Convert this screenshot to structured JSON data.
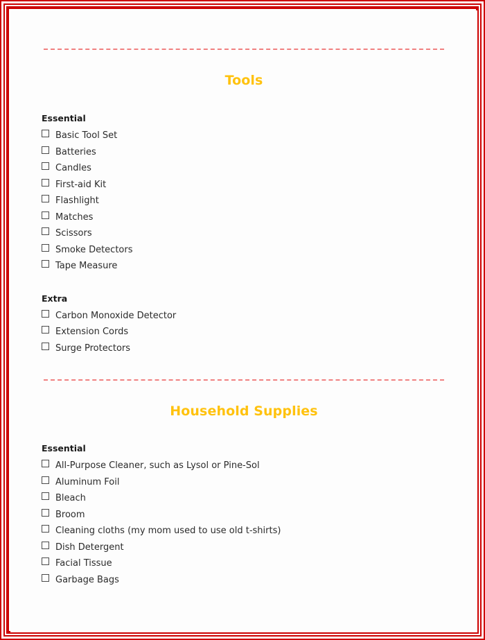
{
  "document": {
    "border_color": "#CC0000",
    "divider_color": "#F08080",
    "heading_color": "#FFC20E",
    "checkbox_glyph": "empty-square-checkbox"
  },
  "sections": [
    {
      "title": "Tools",
      "groups": [
        {
          "label": "Essential",
          "items": [
            "Basic Tool Set",
            "Batteries",
            "Candles",
            "First-aid Kit",
            "Flashlight",
            "Matches",
            "Scissors",
            "Smoke Detectors",
            "Tape Measure"
          ]
        },
        {
          "label": "Extra",
          "items": [
            "Carbon Monoxide Detector",
            "Extension Cords",
            "Surge Protectors"
          ]
        }
      ]
    },
    {
      "title": "Household Supplies",
      "groups": [
        {
          "label": "Essential",
          "items": [
            "All-Purpose Cleaner, such as Lysol or Pine-Sol",
            "Aluminum Foil",
            "Bleach",
            "Broom",
            "Cleaning cloths (my mom used to use old t-shirts)",
            "Dish Detergent",
            "Facial Tissue",
            "Garbage Bags"
          ]
        }
      ]
    }
  ]
}
